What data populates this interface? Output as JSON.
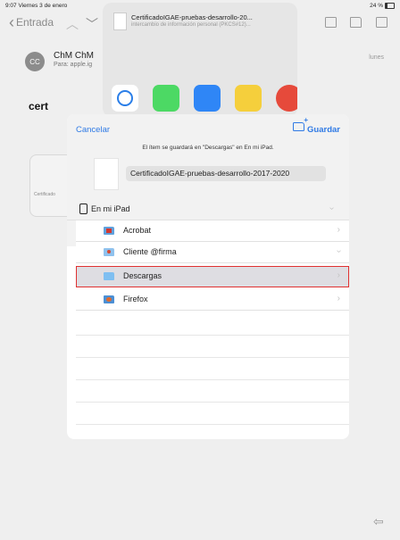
{
  "status": {
    "time": "9:07  Viernes 3 de enero",
    "battery": "24 %"
  },
  "mail_nav": {
    "back_label": "Entrada"
  },
  "share": {
    "filename": "CertificadoIGAE-pruebas-desarrollo-20...",
    "subtitle": "intercambio de información personal (PKCS#12)..."
  },
  "mail": {
    "avatar": "CC",
    "sender": "ChM ChM",
    "to": "Para: apple.ig",
    "date": "lunes",
    "subject": "cert",
    "attachment_label": "Certificado"
  },
  "dialog": {
    "cancel": "Cancelar",
    "save": "Guardar",
    "hint": "El ítem se guardará en \"Descargas\" en En mi iPad.",
    "filename": "CertificadoIGAE-pruebas-desarrollo-2017-2020",
    "root": "En mi iPad",
    "folders": [
      {
        "label": "Acrobat"
      },
      {
        "label": "Cliente @firma"
      },
      {
        "label": "Descargas"
      },
      {
        "label": "Firefox"
      }
    ]
  }
}
